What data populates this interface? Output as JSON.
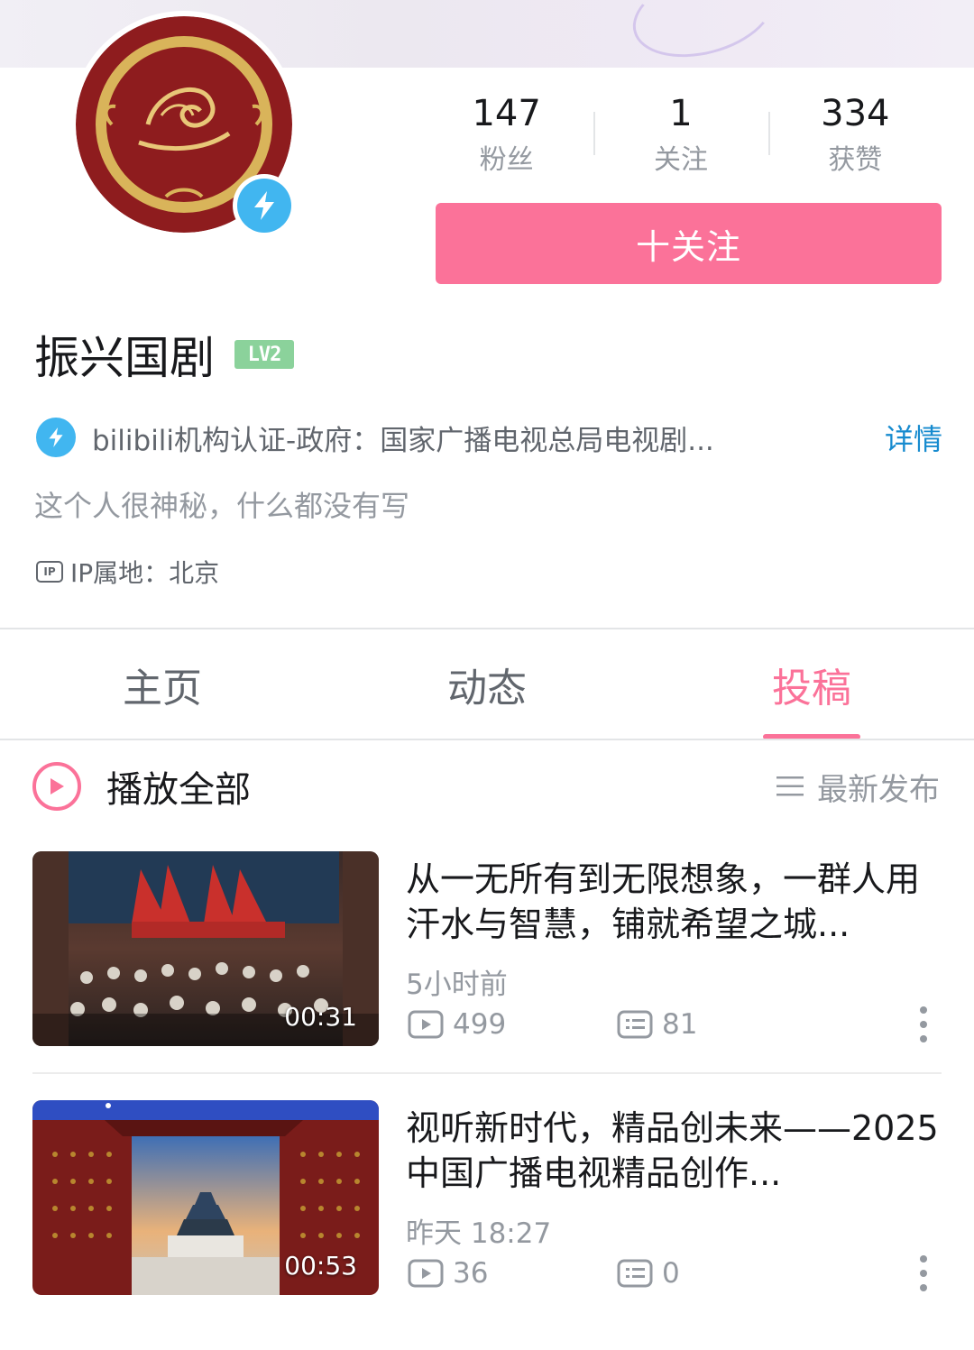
{
  "profile": {
    "name": "振兴国剧",
    "level": "LV2",
    "certification": "bilibili机构认证-政府：国家广播电视总局电视剧...",
    "certification_detail": "详情",
    "bio": "这个人很神秘，什么都没有写",
    "ip_icon": "IP",
    "ip_location": "IP属地：北京"
  },
  "stats": [
    {
      "value": "147",
      "label": "粉丝"
    },
    {
      "value": "1",
      "label": "关注"
    },
    {
      "value": "334",
      "label": "获赞"
    }
  ],
  "follow_button": "十关注",
  "tabs": [
    {
      "label": "主页",
      "active": false
    },
    {
      "label": "动态",
      "active": false
    },
    {
      "label": "投稿",
      "active": true
    }
  ],
  "list_header": {
    "play_all": "播放全部",
    "sort": "最新发布"
  },
  "videos": [
    {
      "title": "从一无所有到无限想象，一群人用汗水与智慧，铺就希望之城...",
      "time": "5小时前",
      "plays": "499",
      "danmaku": "81",
      "duration": "00:31"
    },
    {
      "title": "视听新时代，精品创未来——2025中国广播电视精品创作...",
      "time": "昨天 18:27",
      "plays": "36",
      "danmaku": "0",
      "duration": "00:53"
    }
  ],
  "colors": {
    "accent": "#fb7299",
    "verify_blue": "#41b6f0",
    "link_blue": "#178bcf",
    "level_green": "#8bd29b"
  },
  "icons": [
    "avatar-emblem",
    "lightning-icon",
    "ip-icon",
    "play-circle-icon",
    "sort-list-icon",
    "play-count-icon",
    "danmaku-icon",
    "more-vertical-icon"
  ]
}
